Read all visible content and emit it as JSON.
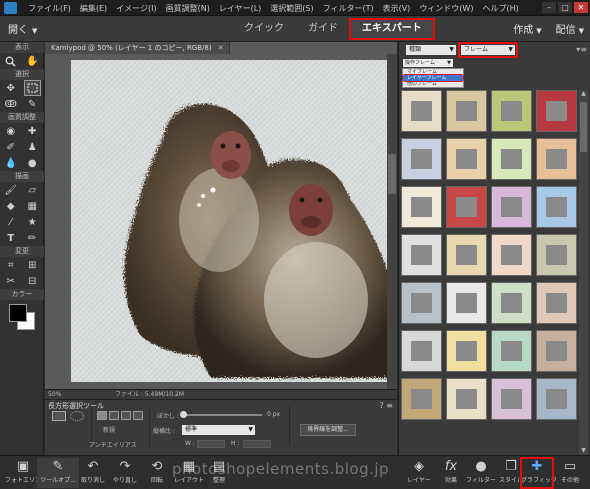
{
  "menubar": {
    "menus": [
      "ファイル(F)",
      "編集(E)",
      "イメージ(I)",
      "画質調整(N)",
      "レイヤー(L)",
      "選択範囲(S)",
      "フィルター(T)",
      "表示(V)",
      "ウィンドウ(W)",
      "ヘルプ(H)"
    ],
    "window_buttons": [
      "–",
      "□",
      "✕"
    ]
  },
  "modebar": {
    "open_label": "開く",
    "tabs": [
      "クイック",
      "ガイド",
      "エキスパート"
    ],
    "active_tab": "エキスパート",
    "create_label": "作成",
    "share_label": "配信"
  },
  "toolbox": {
    "sections": [
      "表示",
      "選択",
      "画質調整",
      "描画",
      "変更",
      "カラー"
    ],
    "foreground_color": "#000000",
    "background_color": "#ffffff"
  },
  "document": {
    "tab_title": "Kamiypod @ 50% (レイヤー 1 のコピー, RGB/8)",
    "zoom": "50%",
    "file_info": "ファイル : 5.49M/10.2M"
  },
  "tool_options": {
    "title": "長方形選択ツール",
    "new_selection_label": "新規",
    "anti_alias_label": "アンチエイリアス",
    "feather_label": "ぼかし :",
    "feather_value": "0 px",
    "aspect_label": "縦横比 :",
    "aspect_value": "標準",
    "width_label": "W :",
    "height_label": "H :",
    "refine_button": "境界線を調整..."
  },
  "panel": {
    "category_select": "種類",
    "type_select": "フレーム",
    "list_select": "操作フレーム",
    "popup_items": [
      "マイフレーム",
      "レイヤーフレーム",
      "他のフレーム"
    ],
    "highlighted_item": "レイヤーフレーム"
  },
  "taskbar": {
    "left": [
      {
        "icon": "photo-bin-icon",
        "label": "フォトエリア"
      },
      {
        "icon": "tool-options-icon",
        "label": "ツールオプ..."
      },
      {
        "icon": "undo-icon",
        "label": "取り消し"
      },
      {
        "icon": "redo-icon",
        "label": "やり直し"
      },
      {
        "icon": "rotate-icon",
        "label": "回転"
      },
      {
        "icon": "layout-icon",
        "label": "レイアウト"
      },
      {
        "icon": "organizer-icon",
        "label": "整理"
      }
    ],
    "right": [
      {
        "icon": "layers-icon",
        "label": "レイヤー"
      },
      {
        "icon": "effects-icon",
        "label": "効果"
      },
      {
        "icon": "filters-icon",
        "label": "フィルター"
      },
      {
        "icon": "styles-icon",
        "label": "スタイル"
      },
      {
        "icon": "graphics-icon",
        "label": "グラフィック"
      },
      {
        "icon": "more-icon",
        "label": "その他"
      }
    ],
    "highlighted": "グラフィック"
  },
  "watermark": "photoshopelements.blog.jp",
  "colors": {
    "highlight_red": "#e01010",
    "selection_blue": "#3d78c8"
  }
}
